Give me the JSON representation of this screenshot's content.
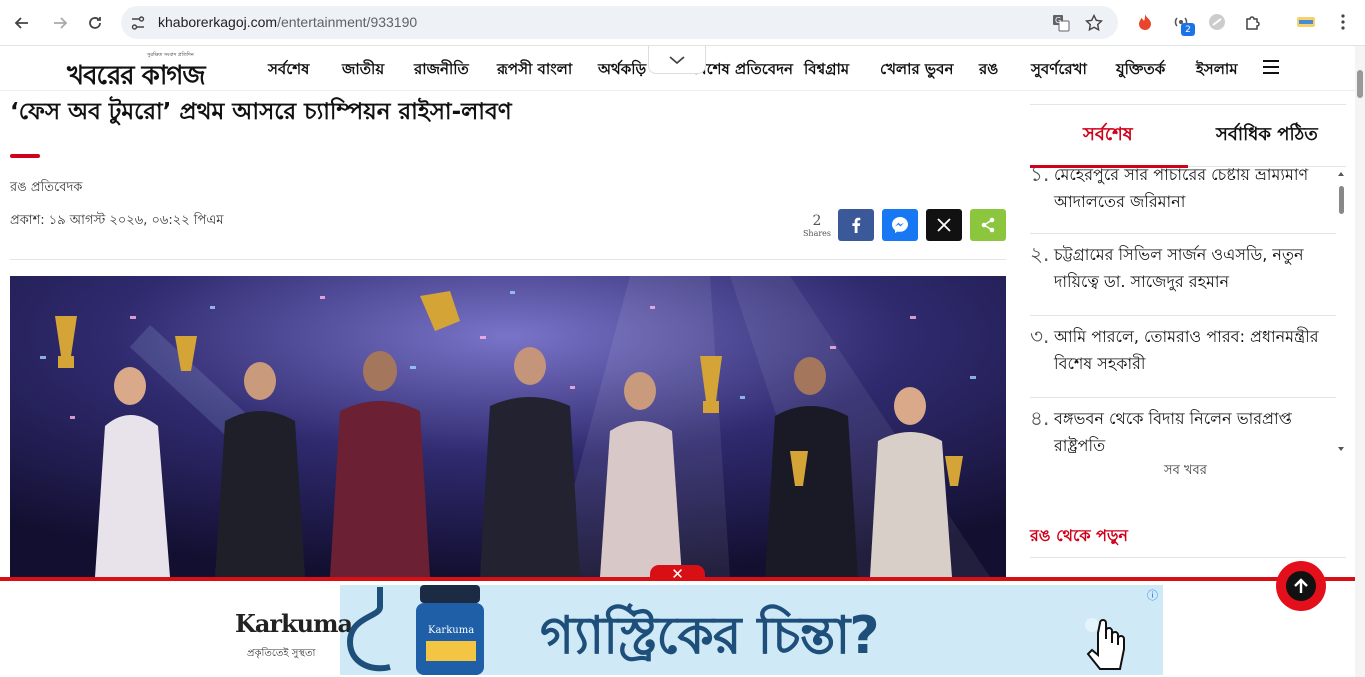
{
  "browser": {
    "url_host": "khaborerkagoj.com",
    "url_path": "/entertainment/933190",
    "extension_badge": "2"
  },
  "site": {
    "logo": "খবরের কাগজ",
    "logo_tagline": "সুরক্ষিত সংবাদ প্রতিদিন",
    "menu": [
      "সর্বশেষ",
      "জাতীয়",
      "রাজনীতি",
      "রূপসী বাংলা",
      "অর্থকড়ি",
      "বিশেষ প্রতিবেদন",
      "বিশ্বগ্রাম",
      "খেলার ভুবন",
      "রঙ",
      "সুবর্ণরেখা",
      "যুক্তিতর্ক",
      "ইসলাম"
    ]
  },
  "article": {
    "title": "‘ফেস অব টুমরো’ প্রথম আসরে চ্যাম্পিয়ন রাইসা-লাবণ",
    "byline": "রঙ প্রতিবেদক",
    "published": "প্রকাশ: ১৯ আগস্ট ২০২৬, ০৬:২২ পিএম",
    "shares_count": "2",
    "shares_label": "Shares",
    "share_icons": [
      "facebook-icon",
      "messenger-icon",
      "x-icon",
      "share-icon"
    ]
  },
  "sidebar": {
    "tabs": [
      "সর্বশেষ",
      "সর্বাধিক পঠিত"
    ],
    "news": [
      {
        "num": "১.",
        "text": "মেহেরপুরে সার পাচারের চেষ্টায় ভ্রাম্যমাণ আদালতের জরিমানা"
      },
      {
        "num": "২.",
        "text": "চট্টগ্রামের সিভিল সার্জন ওএসডি, নতুন দায়িত্বে ডা. সাজেদুর রহমান"
      },
      {
        "num": "৩.",
        "text": "আমি পারলে, তোমরাও পারব: প্রধানমন্ত্রীর বিশেষ সহকারী"
      },
      {
        "num": "৪.",
        "text": "বঙ্গভবন থেকে বিদায় নিলেন ভারপ্রাপ্ত রাষ্ট্রপতি"
      }
    ],
    "all_news": "সব খবর",
    "read_more": "রঙ থেকে পড়ুন"
  },
  "ad": {
    "brand": "Karkuma",
    "tagline": "প্রকৃতিতেই সুস্থতা",
    "headline": "গ্যাস্ট্রিকের চিন্তা?",
    "close": "✕"
  },
  "colors": {
    "accent_red": "#d0021b",
    "facebook": "#3b5998",
    "messenger": "#1877f2",
    "x": "#111111",
    "share": "#8cc63f"
  }
}
